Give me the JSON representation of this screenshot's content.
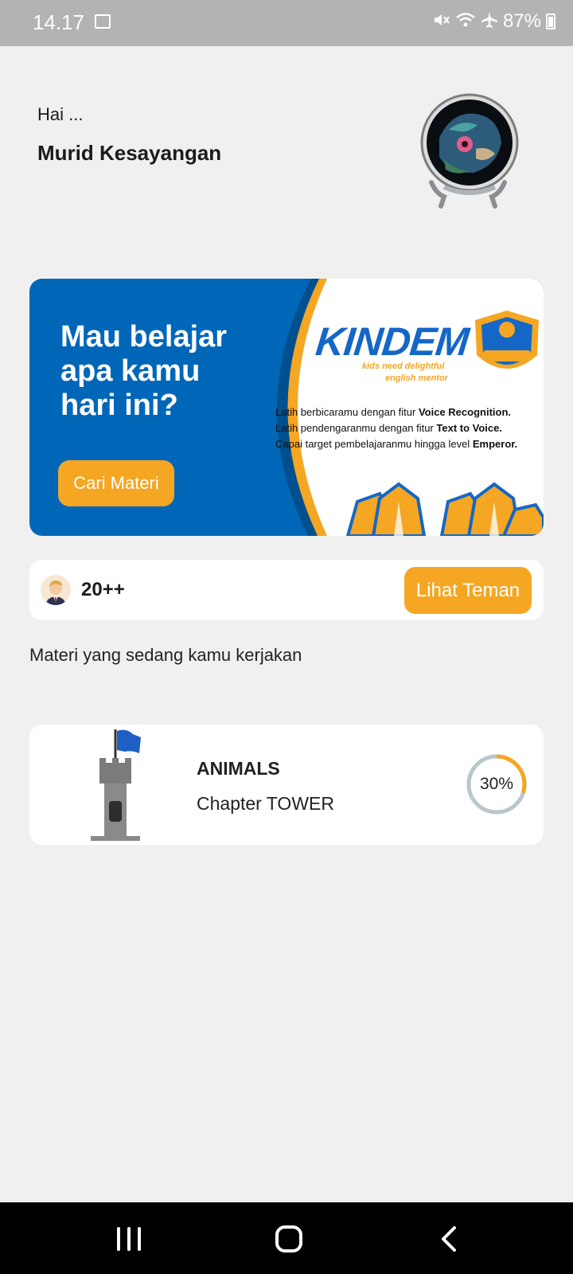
{
  "status_bar": {
    "time": "14.17",
    "battery": "87%",
    "icons": [
      "gallery-icon",
      "mute-icon",
      "wifi-icon",
      "airplane-icon",
      "battery-charging-icon"
    ]
  },
  "greeting": {
    "hello": "Hai ...",
    "name": "Murid Kesayangan"
  },
  "banner": {
    "headline": "Mau belajar apa kamu hari ini?",
    "button_label": "Cari Materi",
    "brand": "KINDEM",
    "tagline_1": "kids need delightful",
    "tagline_2": "english mentor",
    "features": [
      {
        "text": "Latih berbicaramu dengan fitur ",
        "bold": "Voice Recognition."
      },
      {
        "text": "Latih pendengaranmu dengan fitur ",
        "bold": "Text to Voice."
      },
      {
        "text": "Capai target pembelajaranmu hingga level ",
        "bold": "Emperor."
      }
    ]
  },
  "friends": {
    "count": "20++",
    "button_label": "Lihat Teman"
  },
  "materi": {
    "section_title": "Materi yang sedang kamu kerjakan",
    "items": [
      {
        "title": "ANIMALS",
        "subtitle": "Chapter TOWER",
        "progress_label": "30%",
        "progress": 0.3
      }
    ]
  },
  "colors": {
    "accent": "#f5a623",
    "banner_blue": "#0066b8",
    "background": "#f0f0f0"
  }
}
